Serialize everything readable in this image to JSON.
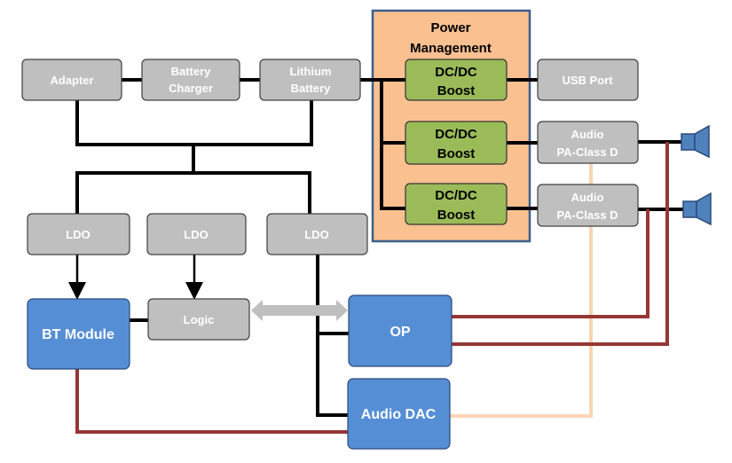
{
  "power_management": {
    "title_line1": "Power",
    "title_line2": "Management"
  },
  "blocks": {
    "adapter": "Adapter",
    "battery_charger": [
      "Battery",
      "Charger"
    ],
    "lithium_battery": [
      "Lithium",
      "Battery"
    ],
    "dcdc": [
      "DC/DC",
      "Boost"
    ],
    "usb_port": "USB Port",
    "audio_pa": [
      "Audio",
      "PA-Class D"
    ],
    "ldo": "LDO",
    "bt_module": "BT Module",
    "logic": "Logic",
    "op": "OP",
    "audio_dac": "Audio DAC"
  },
  "colors": {
    "gray_block": "#bfbfbf",
    "green_block": "#9bbb59",
    "blue_block": "#558ed5",
    "power_mgmt_bg": "#fac090",
    "audio_line": "#953735",
    "dac_line": "#fcd5b5"
  }
}
